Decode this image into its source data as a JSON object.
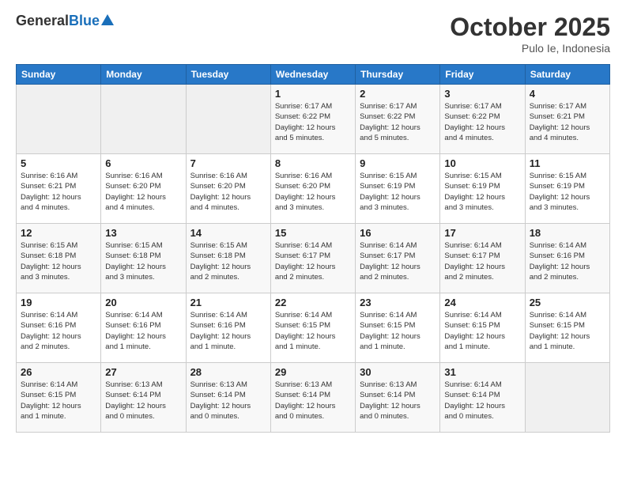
{
  "logo": {
    "general": "General",
    "blue": "Blue"
  },
  "header": {
    "month": "October 2025",
    "location": "Pulo Ie, Indonesia"
  },
  "weekdays": [
    "Sunday",
    "Monday",
    "Tuesday",
    "Wednesday",
    "Thursday",
    "Friday",
    "Saturday"
  ],
  "weeks": [
    [
      {
        "day": "",
        "info": ""
      },
      {
        "day": "",
        "info": ""
      },
      {
        "day": "",
        "info": ""
      },
      {
        "day": "1",
        "info": "Sunrise: 6:17 AM\nSunset: 6:22 PM\nDaylight: 12 hours\nand 5 minutes."
      },
      {
        "day": "2",
        "info": "Sunrise: 6:17 AM\nSunset: 6:22 PM\nDaylight: 12 hours\nand 5 minutes."
      },
      {
        "day": "3",
        "info": "Sunrise: 6:17 AM\nSunset: 6:22 PM\nDaylight: 12 hours\nand 4 minutes."
      },
      {
        "day": "4",
        "info": "Sunrise: 6:17 AM\nSunset: 6:21 PM\nDaylight: 12 hours\nand 4 minutes."
      }
    ],
    [
      {
        "day": "5",
        "info": "Sunrise: 6:16 AM\nSunset: 6:21 PM\nDaylight: 12 hours\nand 4 minutes."
      },
      {
        "day": "6",
        "info": "Sunrise: 6:16 AM\nSunset: 6:20 PM\nDaylight: 12 hours\nand 4 minutes."
      },
      {
        "day": "7",
        "info": "Sunrise: 6:16 AM\nSunset: 6:20 PM\nDaylight: 12 hours\nand 4 minutes."
      },
      {
        "day": "8",
        "info": "Sunrise: 6:16 AM\nSunset: 6:20 PM\nDaylight: 12 hours\nand 3 minutes."
      },
      {
        "day": "9",
        "info": "Sunrise: 6:15 AM\nSunset: 6:19 PM\nDaylight: 12 hours\nand 3 minutes."
      },
      {
        "day": "10",
        "info": "Sunrise: 6:15 AM\nSunset: 6:19 PM\nDaylight: 12 hours\nand 3 minutes."
      },
      {
        "day": "11",
        "info": "Sunrise: 6:15 AM\nSunset: 6:19 PM\nDaylight: 12 hours\nand 3 minutes."
      }
    ],
    [
      {
        "day": "12",
        "info": "Sunrise: 6:15 AM\nSunset: 6:18 PM\nDaylight: 12 hours\nand 3 minutes."
      },
      {
        "day": "13",
        "info": "Sunrise: 6:15 AM\nSunset: 6:18 PM\nDaylight: 12 hours\nand 3 minutes."
      },
      {
        "day": "14",
        "info": "Sunrise: 6:15 AM\nSunset: 6:18 PM\nDaylight: 12 hours\nand 2 minutes."
      },
      {
        "day": "15",
        "info": "Sunrise: 6:14 AM\nSunset: 6:17 PM\nDaylight: 12 hours\nand 2 minutes."
      },
      {
        "day": "16",
        "info": "Sunrise: 6:14 AM\nSunset: 6:17 PM\nDaylight: 12 hours\nand 2 minutes."
      },
      {
        "day": "17",
        "info": "Sunrise: 6:14 AM\nSunset: 6:17 PM\nDaylight: 12 hours\nand 2 minutes."
      },
      {
        "day": "18",
        "info": "Sunrise: 6:14 AM\nSunset: 6:16 PM\nDaylight: 12 hours\nand 2 minutes."
      }
    ],
    [
      {
        "day": "19",
        "info": "Sunrise: 6:14 AM\nSunset: 6:16 PM\nDaylight: 12 hours\nand 2 minutes."
      },
      {
        "day": "20",
        "info": "Sunrise: 6:14 AM\nSunset: 6:16 PM\nDaylight: 12 hours\nand 1 minute."
      },
      {
        "day": "21",
        "info": "Sunrise: 6:14 AM\nSunset: 6:16 PM\nDaylight: 12 hours\nand 1 minute."
      },
      {
        "day": "22",
        "info": "Sunrise: 6:14 AM\nSunset: 6:15 PM\nDaylight: 12 hours\nand 1 minute."
      },
      {
        "day": "23",
        "info": "Sunrise: 6:14 AM\nSunset: 6:15 PM\nDaylight: 12 hours\nand 1 minute."
      },
      {
        "day": "24",
        "info": "Sunrise: 6:14 AM\nSunset: 6:15 PM\nDaylight: 12 hours\nand 1 minute."
      },
      {
        "day": "25",
        "info": "Sunrise: 6:14 AM\nSunset: 6:15 PM\nDaylight: 12 hours\nand 1 minute."
      }
    ],
    [
      {
        "day": "26",
        "info": "Sunrise: 6:14 AM\nSunset: 6:15 PM\nDaylight: 12 hours\nand 1 minute."
      },
      {
        "day": "27",
        "info": "Sunrise: 6:13 AM\nSunset: 6:14 PM\nDaylight: 12 hours\nand 0 minutes."
      },
      {
        "day": "28",
        "info": "Sunrise: 6:13 AM\nSunset: 6:14 PM\nDaylight: 12 hours\nand 0 minutes."
      },
      {
        "day": "29",
        "info": "Sunrise: 6:13 AM\nSunset: 6:14 PM\nDaylight: 12 hours\nand 0 minutes."
      },
      {
        "day": "30",
        "info": "Sunrise: 6:13 AM\nSunset: 6:14 PM\nDaylight: 12 hours\nand 0 minutes."
      },
      {
        "day": "31",
        "info": "Sunrise: 6:14 AM\nSunset: 6:14 PM\nDaylight: 12 hours\nand 0 minutes."
      },
      {
        "day": "",
        "info": ""
      }
    ]
  ]
}
